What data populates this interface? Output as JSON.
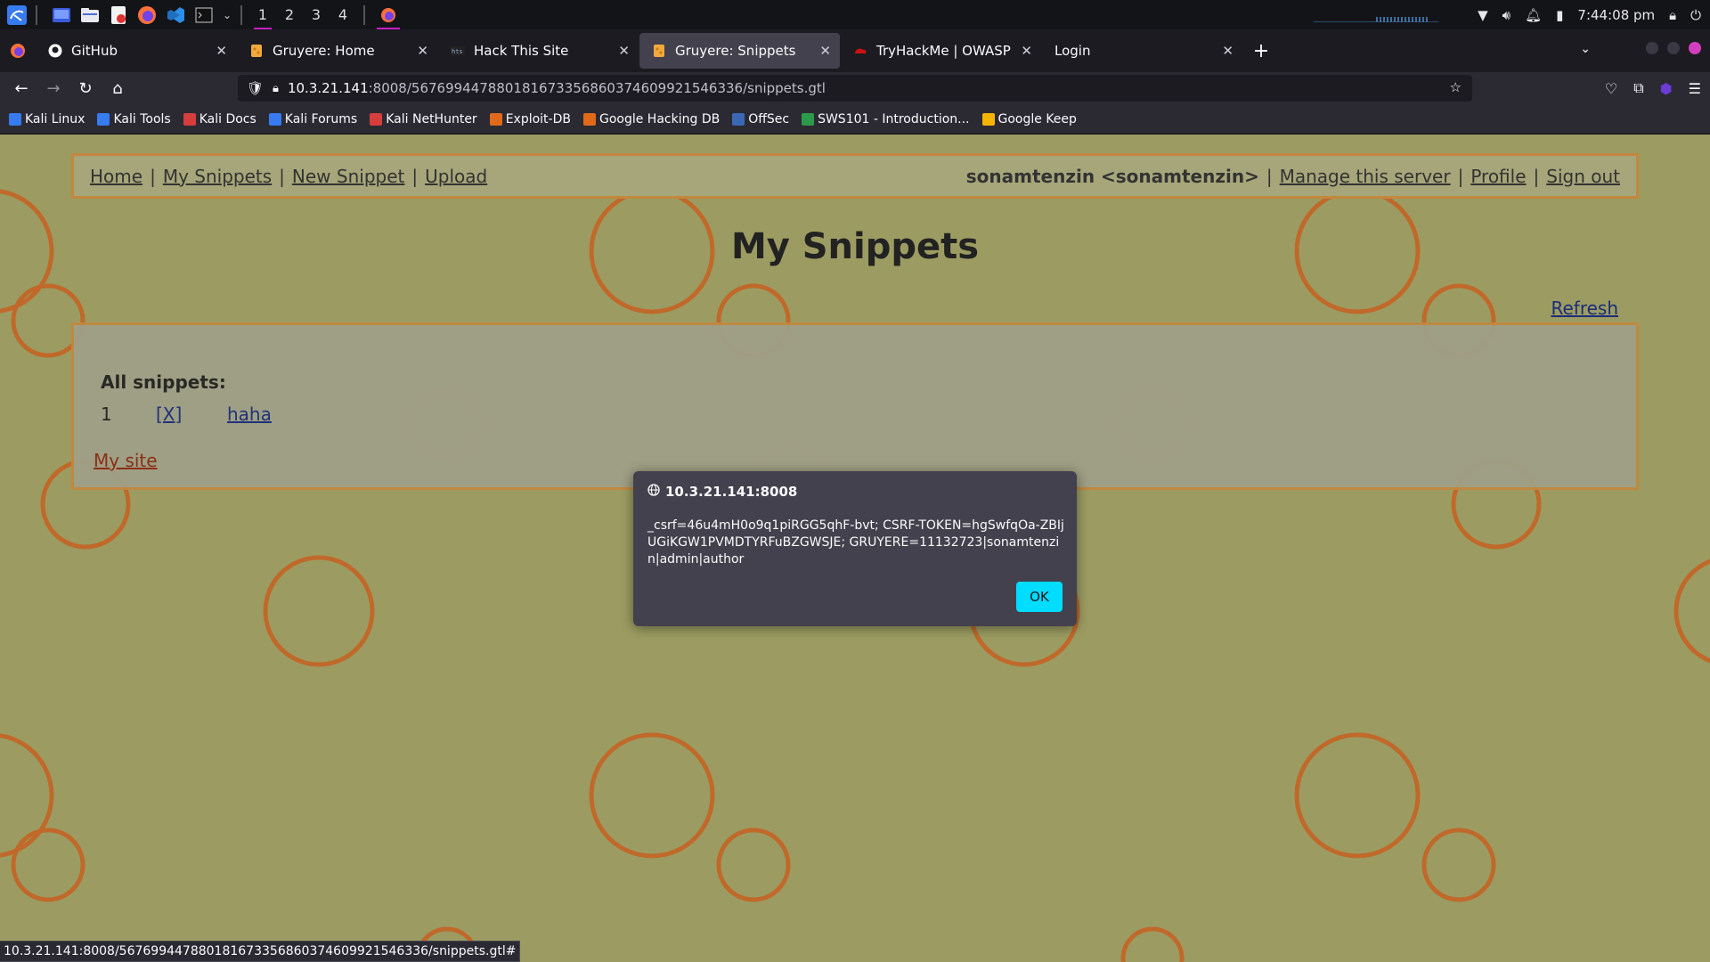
{
  "taskbar": {
    "workspaces": [
      "1",
      "2",
      "3",
      "4"
    ],
    "clock": "7:44:08 pm"
  },
  "tabs": [
    {
      "title": "GitHub",
      "icon": "github-icon"
    },
    {
      "title": "Gruyere: Home",
      "icon": "gruyere-icon"
    },
    {
      "title": "Hack This Site",
      "icon": "hts-icon"
    },
    {
      "title": "Gruyere: Snippets",
      "icon": "gruyere-icon"
    },
    {
      "title": "TryHackMe | OWASP Top",
      "icon": "tryhackme-icon"
    },
    {
      "title": "Login",
      "icon": ""
    }
  ],
  "url": {
    "host": "10.3.21.141",
    "rest": ":8008/567699447880181673356860374609921546336/snippets.gtl"
  },
  "bookmarks": [
    {
      "label": "Kali Linux",
      "color": "#367bf0"
    },
    {
      "label": "Kali Tools",
      "color": "#367bf0"
    },
    {
      "label": "Kali Docs",
      "color": "#d63d3d"
    },
    {
      "label": "Kali Forums",
      "color": "#367bf0"
    },
    {
      "label": "Kali NetHunter",
      "color": "#d63d3d"
    },
    {
      "label": "Exploit-DB",
      "color": "#e06a1a"
    },
    {
      "label": "Google Hacking DB",
      "color": "#e06a1a"
    },
    {
      "label": "OffSec",
      "color": "#3a68b5"
    },
    {
      "label": "SWS101 - Introduction...",
      "color": "#2c9a4a"
    },
    {
      "label": "Google Keep",
      "color": "#f5b400"
    }
  ],
  "menu": {
    "home": "Home",
    "my_snippets": "My Snippets",
    "new_snippet": "New Snippet",
    "upload": "Upload",
    "user": "sonamtenzin <sonamtenzin>",
    "manage": "Manage this server",
    "profile": "Profile",
    "sign_out": "Sign out",
    "sep": "|"
  },
  "page": {
    "title": "My Snippets",
    "refresh": "Refresh",
    "all_snippets": "All snippets:",
    "snippets": [
      {
        "num": "1",
        "delete": "[X]",
        "name": "haha"
      }
    ],
    "my_site": "My site"
  },
  "dialog": {
    "origin": "10.3.21.141:8008",
    "message": "_csrf=46u4mH0o9q1piRGG5qhF-bvt; CSRF-TOKEN=hgSwfqOa-ZBIjUGiKGW1PVMDTYRFuBZGWSJE; GRUYERE=11132723|sonamtenzin|admin|author",
    "ok": "OK"
  },
  "statusbar": {
    "text": "10.3.21.141:8008/567699447880181673356860374609921546336/snippets.gtl#"
  },
  "colors": {
    "page_bg": "#9c9c62",
    "circle": "#c0692a",
    "accent_ok": "#00ddff",
    "link": "#1a2d7a"
  }
}
